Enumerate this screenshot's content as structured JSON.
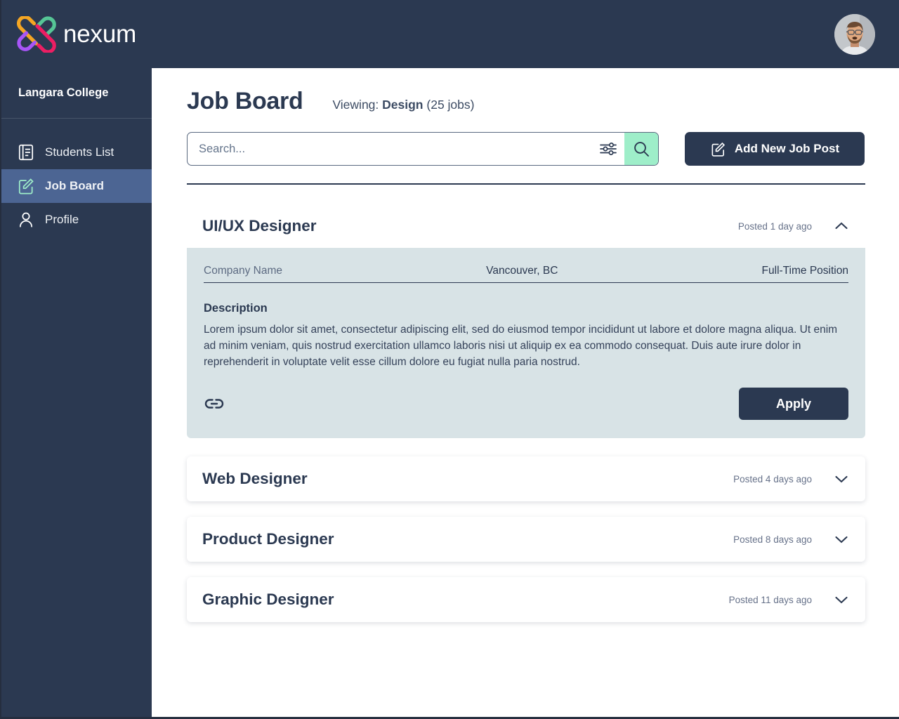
{
  "brand": {
    "name": "nexum",
    "logo_icon": "nexum-interlocking-loops-logo",
    "logo_colors": {
      "orange": "#F5A623",
      "green": "#56C596",
      "purple": "#A855F7",
      "pink": "#EC1E63"
    }
  },
  "topbar": {
    "avatar_icon": "user-avatar-photo"
  },
  "sidebar": {
    "org_name": "Langara College",
    "items": [
      {
        "label": "Students List",
        "icon": "list-document-icon",
        "active": false
      },
      {
        "label": "Job Board",
        "icon": "pencil-edit-icon",
        "active": true
      },
      {
        "label": "Profile",
        "icon": "person-icon",
        "active": false
      }
    ]
  },
  "header": {
    "title": "Job Board",
    "viewing_prefix": "Viewing:",
    "viewing_category": "Design",
    "viewing_count": "(25 jobs)"
  },
  "search": {
    "placeholder": "Search...",
    "value": "",
    "filter_icon": "sliders-filter-icon",
    "search_icon": "magnifier-search-icon",
    "search_button_color": "#9EEEC9"
  },
  "toolbar": {
    "add_job_label": "Add New Job Post",
    "add_job_icon": "pencil-edit-icon"
  },
  "jobs": [
    {
      "title": "UI/UX Designer",
      "posted": "Posted 1 day ago",
      "expanded": true,
      "chevron_icon": "chevron-up-icon",
      "company": "Company Name",
      "location": "Vancouver, BC",
      "type": "Full-Time Position",
      "description_label": "Description",
      "description": "Lorem ipsum dolor sit amet, consectetur adipiscing elit, sed do eiusmod tempor incididunt ut labore et dolore magna aliqua. Ut enim ad minim veniam, quis nostrud exercitation ullamco laboris nisi ut aliquip ex ea commodo consequat. Duis aute irure dolor in reprehenderit in voluptate velit esse cillum dolore eu fugiat nulla paria nostrud.",
      "link_icon": "chain-link-icon",
      "apply_label": "Apply"
    },
    {
      "title": "Web Designer",
      "posted": "Posted 4 days ago",
      "expanded": false,
      "chevron_icon": "chevron-down-icon"
    },
    {
      "title": "Product Designer",
      "posted": "Posted 8 days ago",
      "expanded": false,
      "chevron_icon": "chevron-down-icon"
    },
    {
      "title": "Graphic Designer",
      "posted": "Posted 11 days ago",
      "expanded": false,
      "chevron_icon": "chevron-down-icon"
    }
  ],
  "colors": {
    "navy": "#2B3951",
    "sidebar_active": "#4C6593",
    "mint": "#9EEEC9",
    "card_body": "#D8E3E6"
  }
}
